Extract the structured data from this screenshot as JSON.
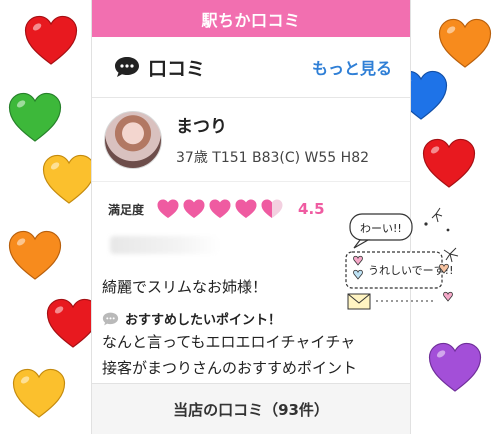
{
  "topbar": {
    "title": "駅ちか口コミ"
  },
  "section": {
    "title": "口コミ",
    "more_link": "もっと見る"
  },
  "profile": {
    "name": "まつり",
    "specs": "37歳 T151 B83(C) W55 H82"
  },
  "rating": {
    "label": "満足度",
    "score": "4.5",
    "value": 4.5,
    "max": 5,
    "color": "#ef5ba1"
  },
  "review": {
    "title": "綺麗でスリムなお姉様！",
    "point_label": "おすすめしたいポイント！",
    "text_line1": "なんと言ってもエロエロイチャイチャ",
    "text_line2": "接客がまつりさんのおすすめポイント"
  },
  "footer": {
    "label": "当店の口コミ（93件）"
  },
  "sticker": {
    "line1": "わーい!!",
    "line2": "うれしいでーす!!"
  },
  "colors": {
    "brand_pink": "#f26fb0",
    "link_blue": "#2f7fd6",
    "heart_red": "#e8191f",
    "heart_orange": "#f78b1d",
    "heart_yellow": "#fbc02d",
    "heart_green": "#3db83a",
    "heart_blue": "#1e73e8",
    "heart_purple": "#a34fd8"
  },
  "decor_hearts": [
    "red-heart-icon",
    "green-heart-icon",
    "yellow-heart-icon",
    "orange-heart-icon",
    "blue-heart-icon",
    "purple-heart-icon"
  ]
}
